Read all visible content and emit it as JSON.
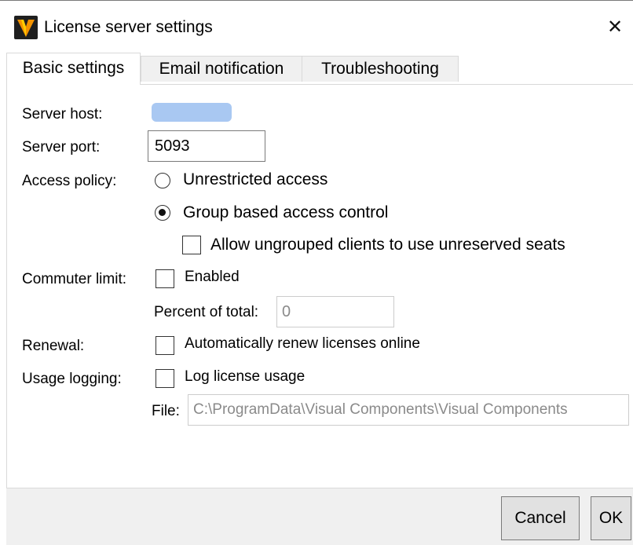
{
  "window": {
    "title": "License server settings",
    "close_glyph": "✕",
    "app_icon": "visual-components-logo-icon",
    "colors": {
      "logo_bg": "#1f1f1f",
      "logo_orange": "#f39200",
      "logo_yellow": "#ffcc00"
    }
  },
  "tabs": [
    {
      "label": "Basic settings",
      "active": true
    },
    {
      "label": "Email notification",
      "active": false
    },
    {
      "label": "Troubleshooting",
      "active": false
    }
  ],
  "server_host": {
    "label": "Server host:"
  },
  "server_port": {
    "label": "Server port:",
    "value": "5093"
  },
  "access_policy": {
    "label": "Access policy:",
    "options": [
      {
        "label": "Unrestricted access",
        "selected": false
      },
      {
        "label": "Group based access control",
        "selected": true
      }
    ],
    "allow_ungrouped": {
      "label": "Allow ungrouped clients to use unreserved seats",
      "checked": false
    }
  },
  "commuter_limit": {
    "label": "Commuter limit:",
    "enabled_label": "Enabled",
    "enabled": false,
    "percent_label": "Percent of total:",
    "percent_value": "0"
  },
  "renewal": {
    "label": "Renewal:",
    "checkbox_label": "Automatically renew licenses online",
    "checked": false
  },
  "usage_logging": {
    "label": "Usage logging:",
    "checkbox_label": "Log license usage",
    "checked": false,
    "file_label": "File:",
    "file_value": "C:\\ProgramData\\Visual Components\\Visual Components"
  },
  "footer": {
    "cancel_label": "Cancel",
    "ok_label": "OK"
  }
}
